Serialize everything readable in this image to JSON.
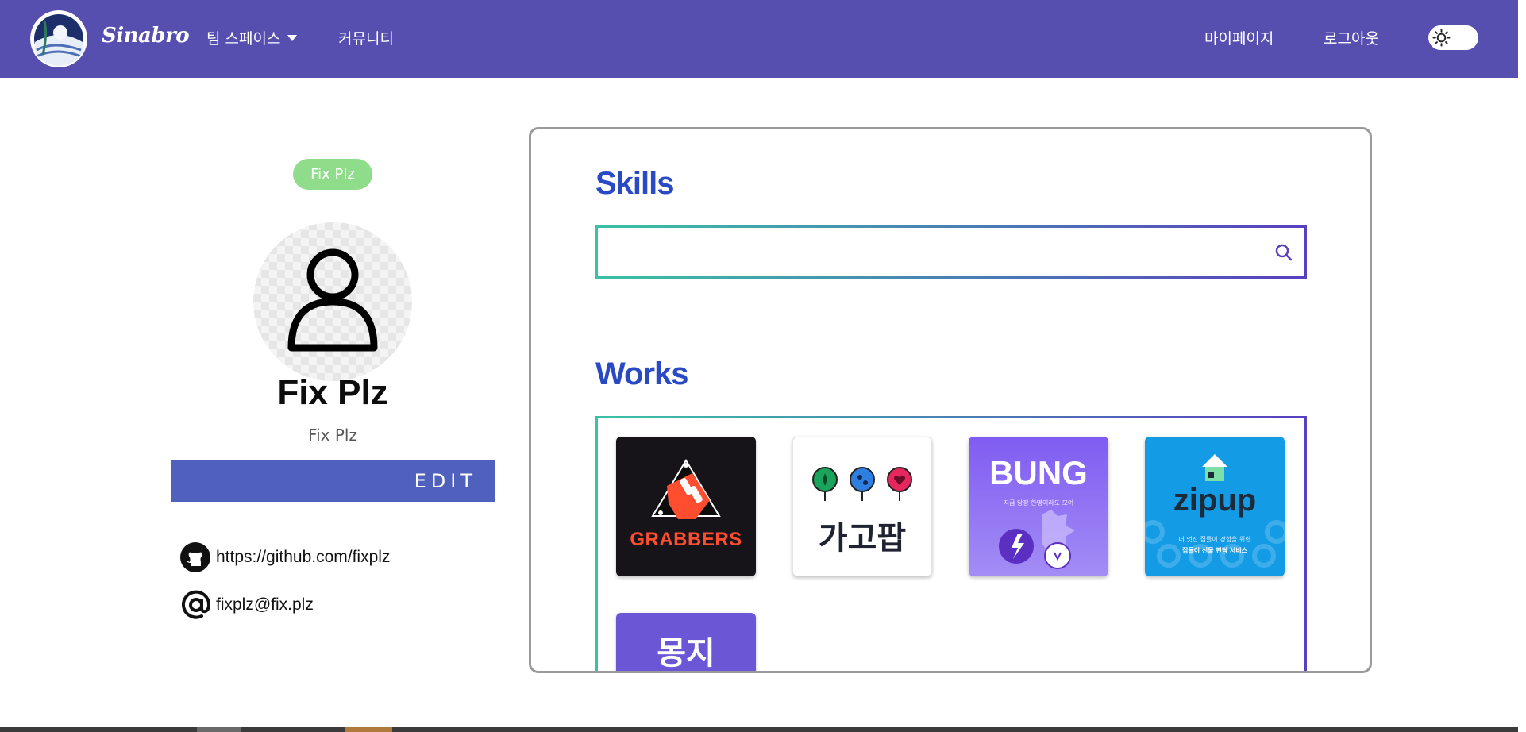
{
  "colors": {
    "navbar": "#574fb0",
    "accent_title": "#2a49c5",
    "edit_button": "#5061bd",
    "team_badge": "#8fdd8a",
    "gradient_start": "#3ac2a6",
    "gradient_end": "#5a3fc0"
  },
  "header": {
    "brand": "Sinabro",
    "logo_icon": "sinabro-logo",
    "nav": {
      "team_space": "팀 스페이스",
      "team_space_icon": "caret-down-icon",
      "community": "커뮤니티",
      "mypage": "마이페이지",
      "logout": "로그아웃"
    },
    "theme_toggle_icon": "sun-icon"
  },
  "profile": {
    "team_badge": "Fix Plz",
    "avatar_icon": "user-icon",
    "name": "Fix Plz",
    "subtitle": "Fix Plz",
    "edit_label": "EDIT",
    "github_icon": "github-icon",
    "github_url": "https://github.com/fixplz",
    "email_icon": "at-sign-icon",
    "email": "fixplz@fix.plz"
  },
  "skills": {
    "title": "Skills",
    "search_value": "",
    "search_icon": "search-icon"
  },
  "works": {
    "title": "Works",
    "items": [
      {
        "logo_text": "GRABBERS",
        "background": "#161418"
      },
      {
        "logo_text": "가고팝",
        "background": "#ffffff"
      },
      {
        "logo_text": "BUNG",
        "tagline": "지금 당장 한명이라도 모여",
        "background": "#7f5cf2"
      },
      {
        "logo_text": "zipup",
        "tagline_1": "더 멋진 집들이 경험을 위한",
        "tagline_2": "집들이 선물 펀딩 서비스",
        "background": "#139be6"
      },
      {
        "logo_text": "몽지",
        "background": "#6b57d6"
      }
    ]
  }
}
